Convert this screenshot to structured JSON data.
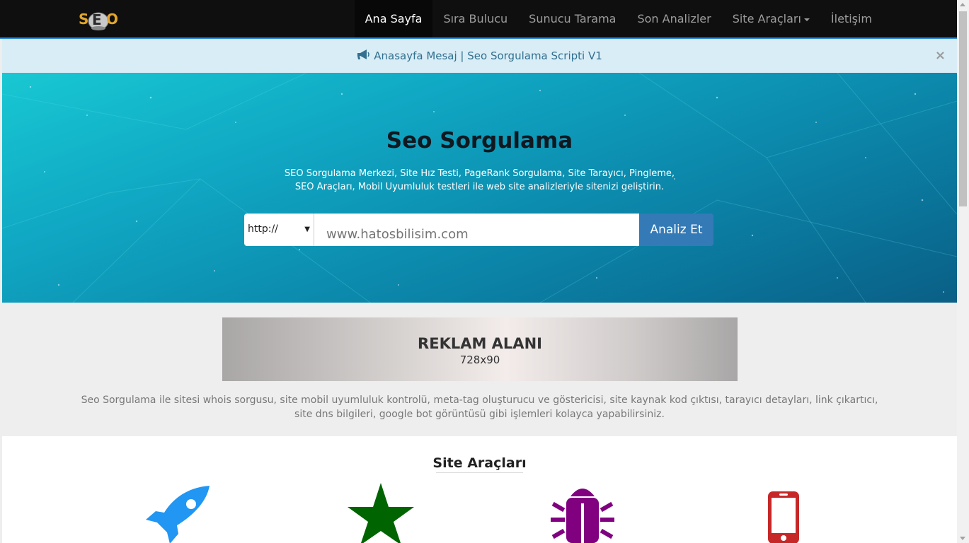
{
  "logo": {
    "text": "SEO"
  },
  "nav": {
    "items": [
      {
        "label": "Ana Sayfa",
        "active": true
      },
      {
        "label": "Sıra Bulucu"
      },
      {
        "label": "Sunucu Tarama"
      },
      {
        "label": "Son Analizler"
      },
      {
        "label": "Site Araçları",
        "dropdown": true
      },
      {
        "label": "İletişim"
      }
    ]
  },
  "alert": {
    "icon": "bullhorn-icon",
    "text": "Anasayfa Mesaj | Seo Sorgulama Scripti V1",
    "close": "×"
  },
  "hero": {
    "title": "Seo Sorgulama",
    "subtitle_line1": "SEO Sorgulama Merkezi, Site Hız Testi, PageRank Sorgulama, Site Tarayıcı, Pingleme,",
    "subtitle_line2": "SEO Araçları, Mobil Uyumluluk testleri ile web site analizleriyle sitenizi geliştirin.",
    "protocol": "http://",
    "url_placeholder": "www.hatosbilisim.com",
    "button": "Analiz Et"
  },
  "ad": {
    "title": "REKLAM ALANI",
    "size": "728x90"
  },
  "description": "Seo Sorgulama ile sitesi whois sorgusu, site mobil uyumluluk kontrolü, meta-tag oluşturucu ve göstericisi, site kaynak kod çıktısı, tarayıcı detayları, link çıkartıcı, site dns bilgileri, google bot görüntüsü gibi işlemleri kolayca yapabilirsiniz.",
  "tools": {
    "title": "Site Araçları",
    "icons": [
      {
        "name": "rocket-icon",
        "color": "#2196f3"
      },
      {
        "name": "star-icon",
        "color": "#006400"
      },
      {
        "name": "bug-icon",
        "color": "#800080"
      },
      {
        "name": "mobile-icon",
        "color": "#c62828"
      }
    ]
  },
  "colors": {
    "navbar": "#0f0f0f",
    "accent": "#337ab7",
    "alert_bg": "#d9edf7"
  }
}
